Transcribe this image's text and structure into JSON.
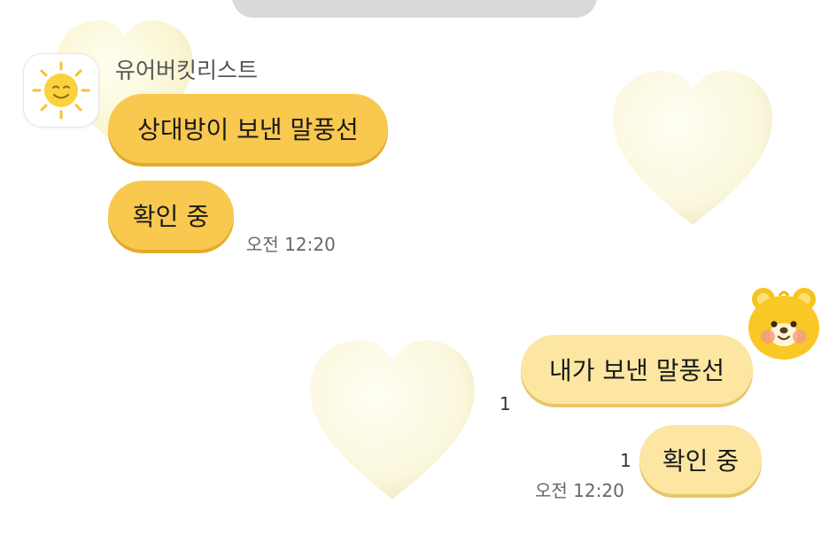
{
  "incoming": {
    "sender_name": "유어버킷리스트",
    "messages": [
      {
        "text": "상대방이 보낸 말풍선"
      },
      {
        "text": "확인 중"
      }
    ],
    "time": "오전 12:20"
  },
  "outgoing": {
    "messages": [
      {
        "text": "내가 보낸 말풍선",
        "unread": "1"
      },
      {
        "text": "확인 중",
        "unread": "1"
      }
    ],
    "time": "오전 12:20"
  },
  "colors": {
    "incoming_bubble": "#f8c84f",
    "outgoing_bubble": "#fce6a2",
    "heart": "#fbf8dc",
    "background": "#ffffff"
  },
  "icons": {
    "sender_avatar": "smiling-sun-icon",
    "my_avatar": "yellow-bear-icon",
    "decoration": "heart-icon"
  }
}
